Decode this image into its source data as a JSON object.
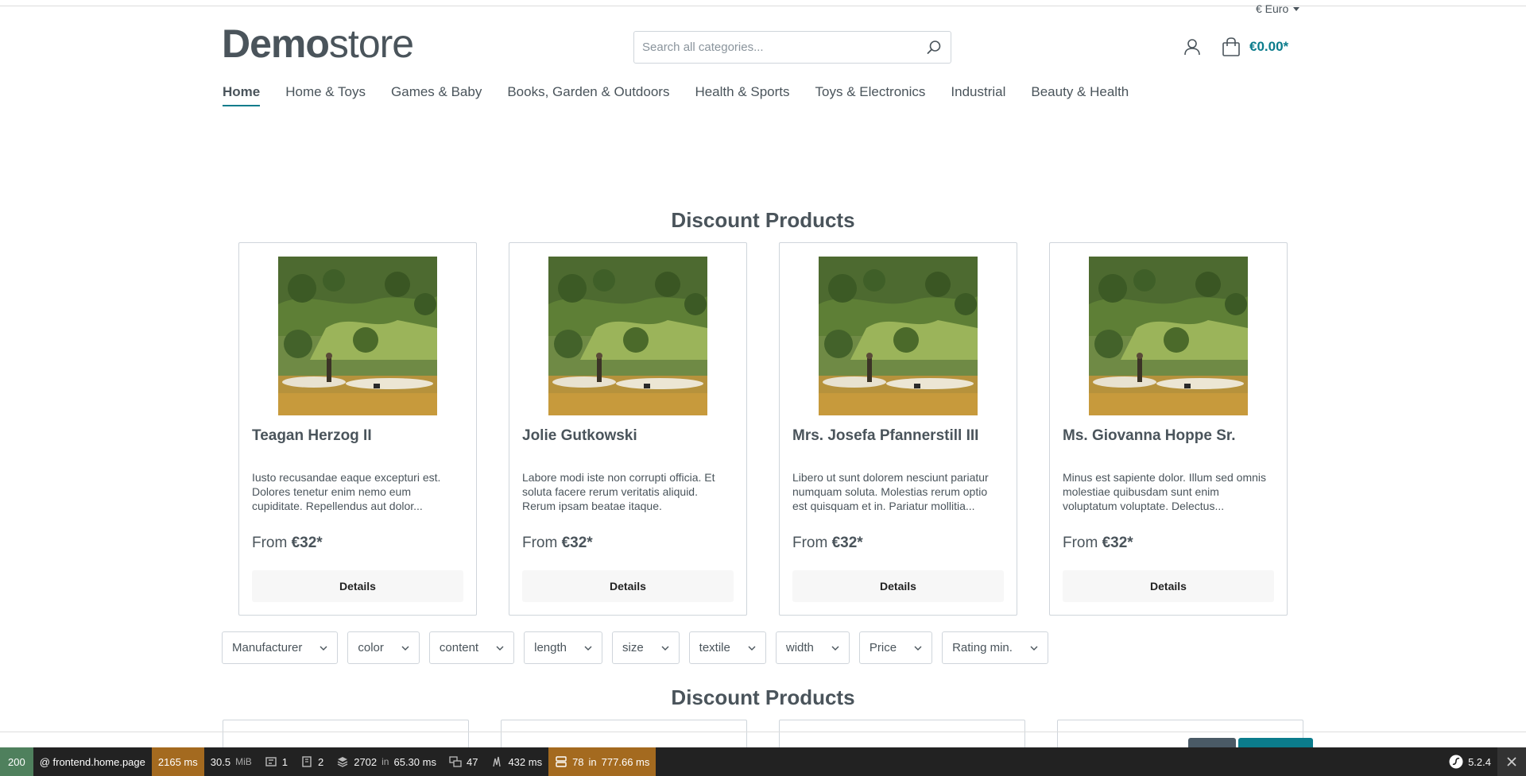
{
  "header": {
    "currency": "€ Euro",
    "logo_bold": "Demo",
    "logo_light": "store",
    "search_placeholder": "Search all categories...",
    "cart_total": "€0.00*"
  },
  "nav": {
    "items": [
      {
        "label": "Home",
        "active": true
      },
      {
        "label": "Home & Toys"
      },
      {
        "label": "Games & Baby"
      },
      {
        "label": "Books, Garden & Outdoors"
      },
      {
        "label": "Health & Sports"
      },
      {
        "label": "Toys & Electronics"
      },
      {
        "label": "Industrial"
      },
      {
        "label": "Beauty & Health"
      }
    ]
  },
  "sections": {
    "discount_title_1": "Discount Products",
    "discount_title_2": "Discount Products"
  },
  "products": [
    {
      "name": "Teagan Herzog II",
      "description": "Iusto recusandae eaque excepturi est. Dolores tenetur enim nemo eum cupiditate. Repellendus aut dolor...",
      "price_prefix": "From",
      "price": "€32*",
      "button": "Details"
    },
    {
      "name": "Jolie Gutkowski",
      "description": "Labore modi iste non corrupti officia. Et soluta facere rerum veritatis aliquid. Rerum ipsam beatae itaque.",
      "price_prefix": "From",
      "price": "€32*",
      "button": "Details"
    },
    {
      "name": "Mrs. Josefa Pfannerstill III",
      "description": "Libero ut sunt dolorem nesciunt pariatur numquam soluta. Molestias rerum optio est quisquam et in. Pariatur mollitia...",
      "price_prefix": "From",
      "price": "€32*",
      "button": "Details"
    },
    {
      "name": "Ms. Giovanna Hoppe Sr.",
      "description": "Minus est sapiente dolor. Illum sed omnis molestiae quibusdam sunt enim voluptatum voluptate. Delectus...",
      "price_prefix": "From",
      "price": "€32*",
      "button": "Details"
    }
  ],
  "filters": [
    "Manufacturer",
    "color",
    "content",
    "length",
    "size",
    "textile",
    "width",
    "Price",
    "Rating min."
  ],
  "toolbar": {
    "status": "200",
    "route": "@ frontend.home.page",
    "time": "2165 ms",
    "memory_value": "30.5",
    "memory_unit": "MiB",
    "forms": "1",
    "logs": "2",
    "db_queries": "2702",
    "db_in": "in",
    "db_time": "65.30 ms",
    "translations": "47",
    "events_time": "432 ms",
    "cache": "78",
    "cache_in": "in",
    "cache_time": "777.66 ms",
    "symfony_version": "5.2.4"
  },
  "colors": {
    "accent": "#0b7c8c",
    "text": "#4a545b",
    "border": "#cfd5db",
    "toolbar_bg": "#222222",
    "toolbar_ok": "#4f805d",
    "toolbar_warn": "#a46a1f"
  }
}
